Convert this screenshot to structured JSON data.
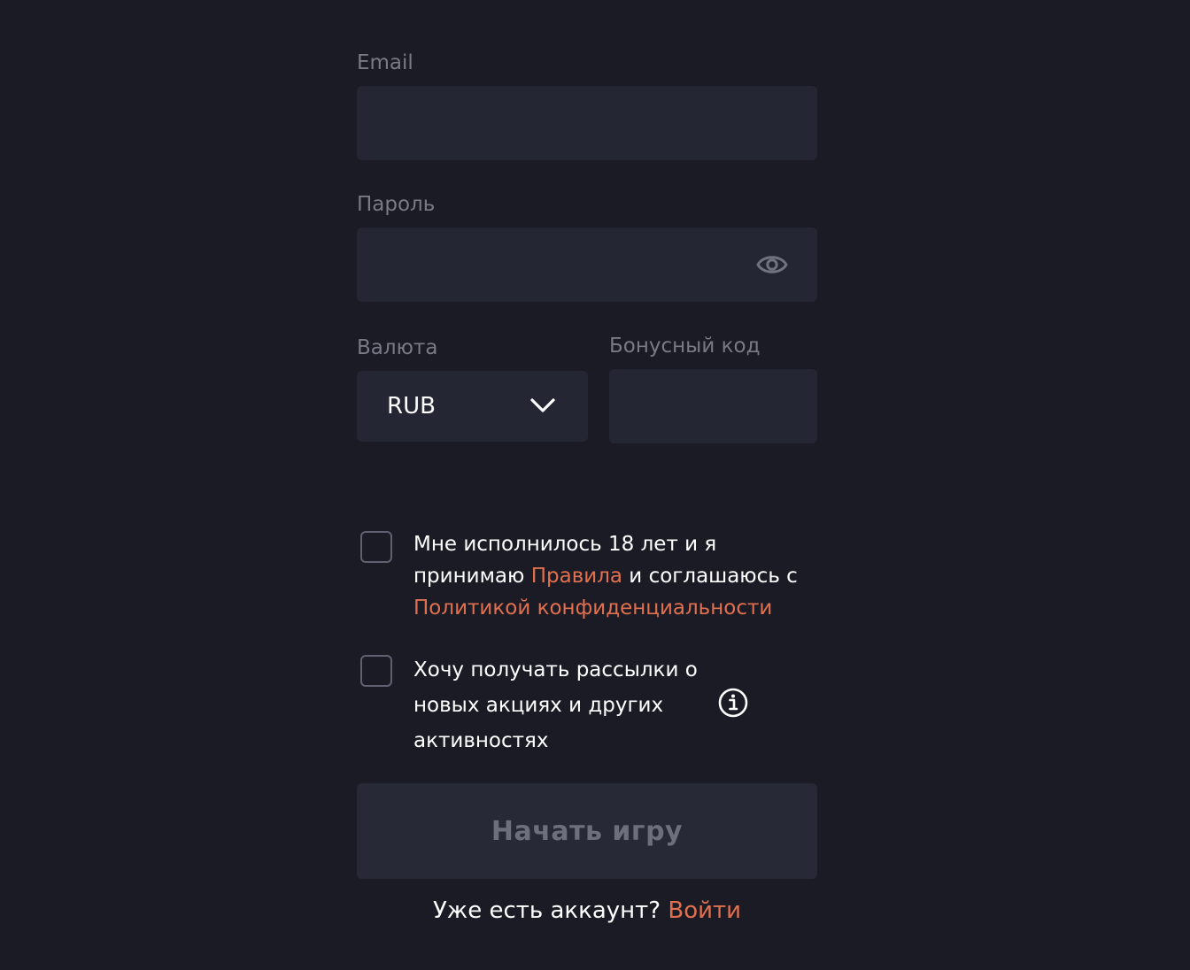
{
  "form": {
    "email": {
      "label": "Email",
      "value": "",
      "placeholder": ""
    },
    "password": {
      "label": "Пароль",
      "value": "",
      "placeholder": "",
      "toggle_icon": "eye-icon"
    },
    "currency": {
      "label": "Валюта",
      "selected": "RUB",
      "dropdown_icon": "chevron-down-icon"
    },
    "bonus_code": {
      "label": "Бонусный код",
      "value": "",
      "placeholder": ""
    },
    "agree_terms": {
      "checked": false,
      "text_before": "Мне исполнилось 18 лет и я принимаю ",
      "rules_link": "Правила",
      "text_middle": " и соглашаюсь с ",
      "privacy_link": "Политикой конфиденциальности"
    },
    "newsletter": {
      "checked": false,
      "text": "Хочу получать рассылки о новых акциях и других активностях",
      "info_icon": "info-icon"
    },
    "submit_label": "Начать игру",
    "login_prompt": "Уже есть аккаунт?",
    "login_link": "Войти"
  },
  "colors": {
    "background": "#1b1b26",
    "field": "#242633",
    "label": "#787a86",
    "accent": "#e1704f",
    "submit_disabled": "#272936"
  }
}
